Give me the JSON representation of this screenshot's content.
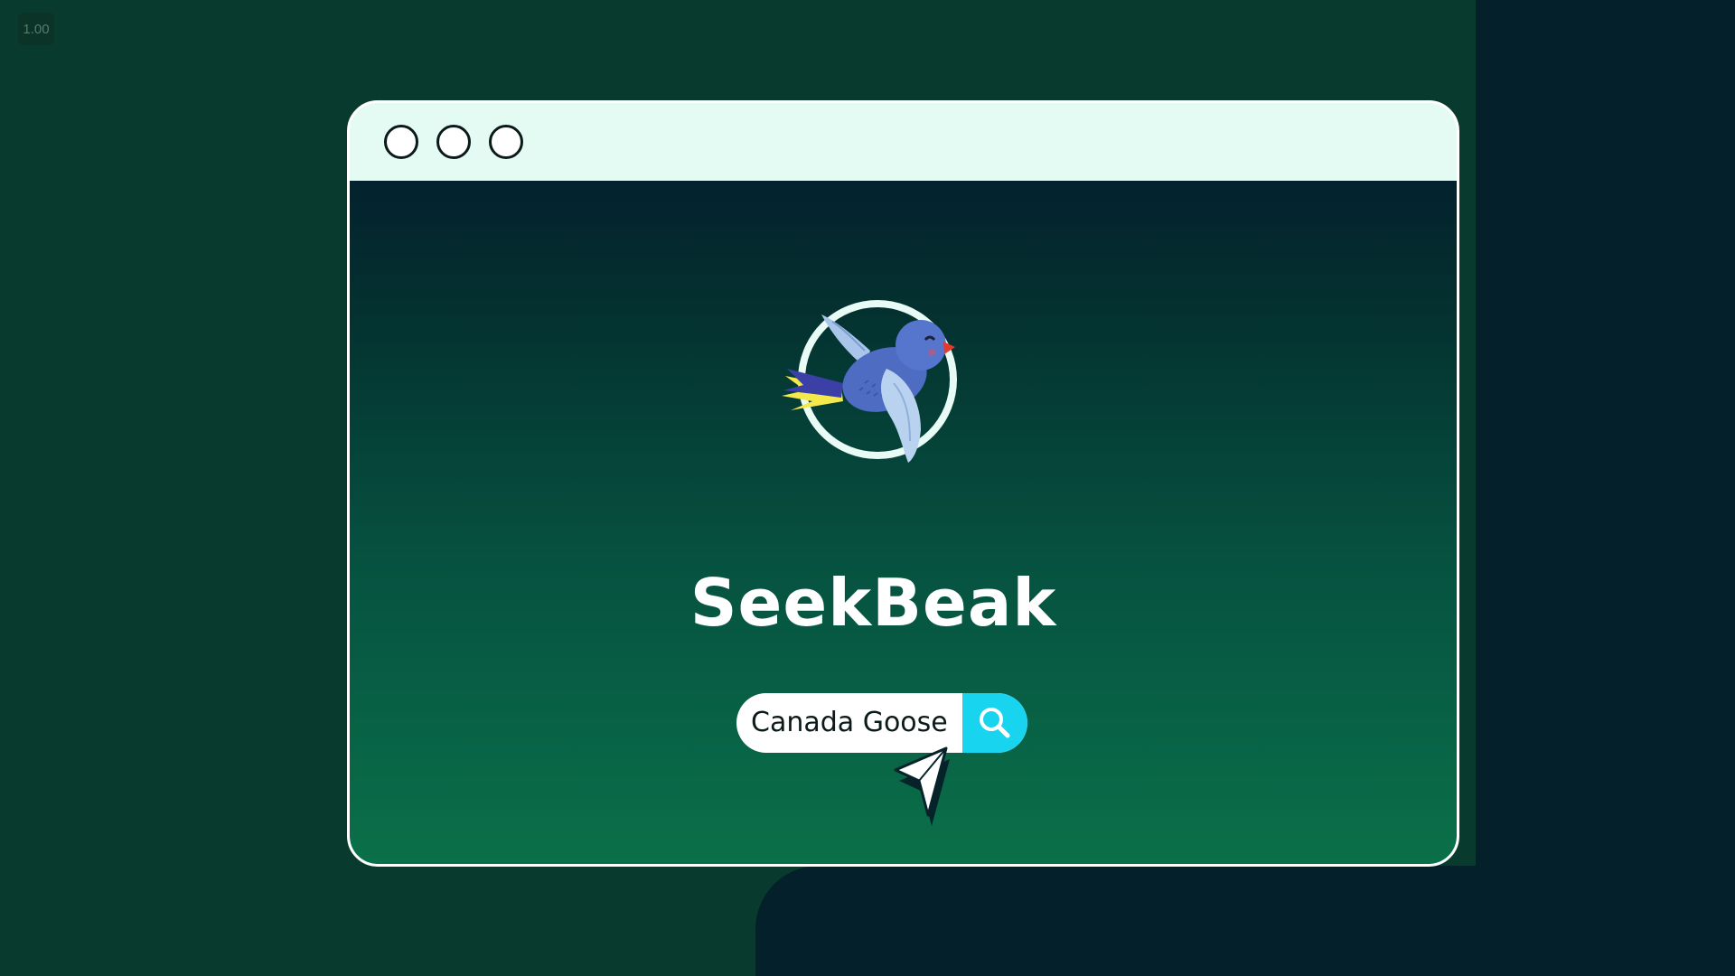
{
  "zoom": "1.00",
  "window": {
    "controls": [
      "close",
      "minimize",
      "maximize"
    ]
  },
  "brand": {
    "name": "SeekBeak",
    "logo_icon": "bird-in-ring-icon"
  },
  "search": {
    "value": "Canada Goose",
    "button_icon": "search-icon"
  },
  "colors": {
    "titlebar": "#e4fbf3",
    "search_button": "#18d4ef",
    "background": "#083a2e"
  }
}
